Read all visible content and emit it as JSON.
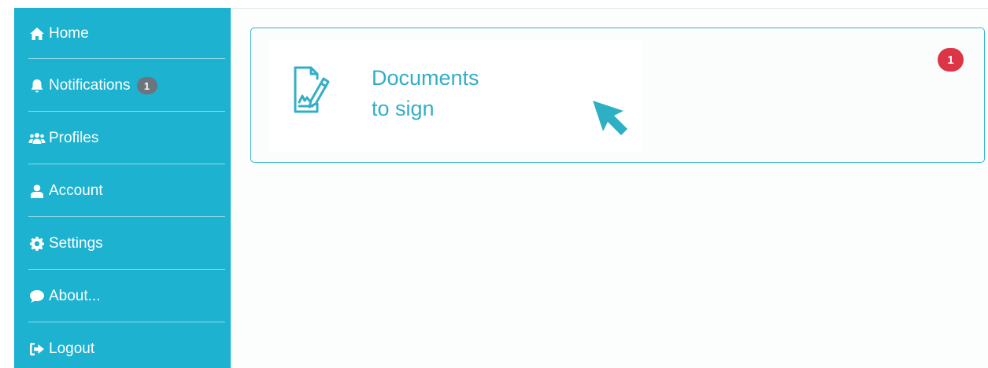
{
  "sidebar": {
    "items": [
      {
        "label": "Home",
        "icon": "home-icon"
      },
      {
        "label": "Notifications",
        "icon": "bell-icon",
        "badge": "1"
      },
      {
        "label": "Profiles",
        "icon": "users-icon"
      },
      {
        "label": "Account",
        "icon": "user-icon"
      },
      {
        "label": "Settings",
        "icon": "gear-icon"
      },
      {
        "label": "About...",
        "icon": "comment-icon"
      },
      {
        "label": "Logout",
        "icon": "sign-out-icon"
      }
    ]
  },
  "main": {
    "card": {
      "title_line1": "Documents",
      "title_line2": "to sign",
      "icon": "signed-document-icon",
      "badge": "1"
    }
  },
  "colors": {
    "sidebar_bg": "#1cb2d0",
    "accent": "#32aec8",
    "nav_badge": "#6c757d",
    "alert_badge": "#dc3545"
  }
}
